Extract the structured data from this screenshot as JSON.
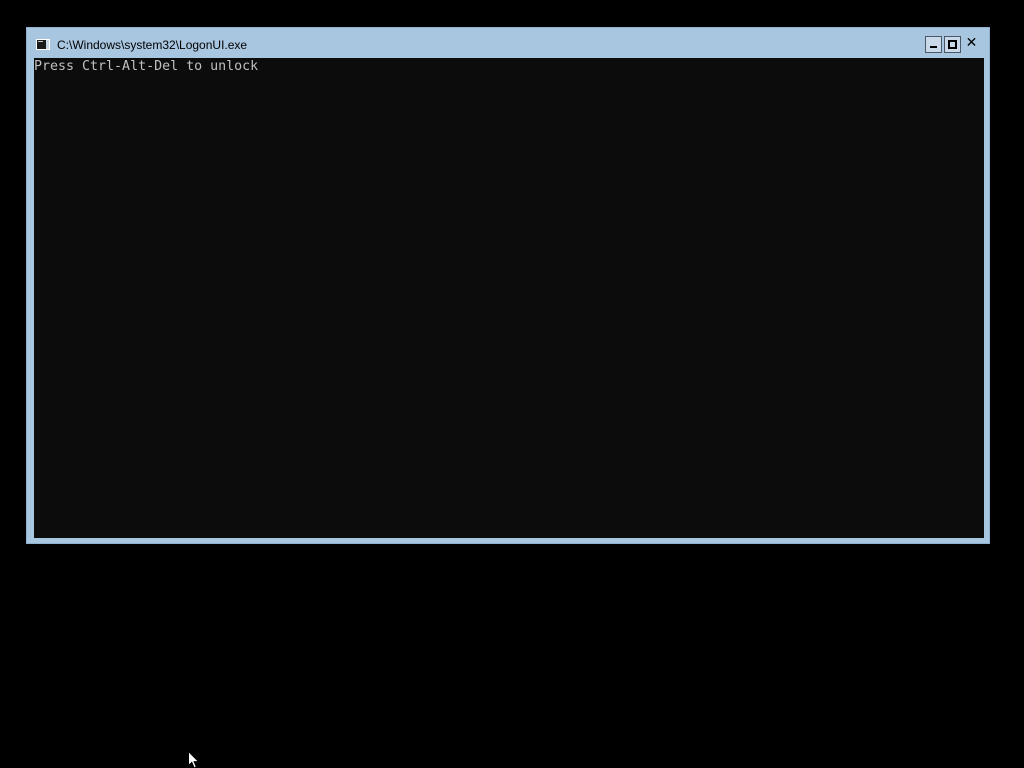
{
  "window": {
    "title": "C:\\Windows\\system32\\LogonUI.exe",
    "icon": "console-app-icon",
    "caption_buttons": [
      "minimize-icon",
      "maximize-icon",
      "close-icon"
    ]
  },
  "console": {
    "lines": [
      "Press Ctrl-Alt-Del to unlock"
    ],
    "text_color": "#c0c0c0",
    "background_color": "#0c0c0c"
  },
  "desktop": {
    "background_color": "#000000",
    "cursor": "arrow-cursor-icon"
  },
  "colors": {
    "window_frame": "#a9c6e0"
  }
}
